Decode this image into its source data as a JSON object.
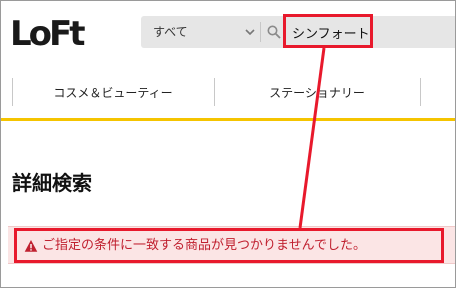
{
  "header": {
    "logo_text": "LoFt",
    "category_select": "すべて",
    "search": {
      "value": "シンフォート",
      "placeholder": ""
    }
  },
  "nav": {
    "items": [
      {
        "label": "コスメ＆ビューティー"
      },
      {
        "label": "ステーショナリー"
      }
    ]
  },
  "page": {
    "title": "詳細検索",
    "alert_message": "ご指定の条件に一致する商品が見つかりませんでした。"
  },
  "colors": {
    "accent_gold": "#f5c400",
    "annotation_red": "#e8192c",
    "alert_bg": "#fbe5e5",
    "alert_text": "#c0202f"
  },
  "icons": [
    "chevron-down-icon",
    "search-icon",
    "warning-icon"
  ]
}
